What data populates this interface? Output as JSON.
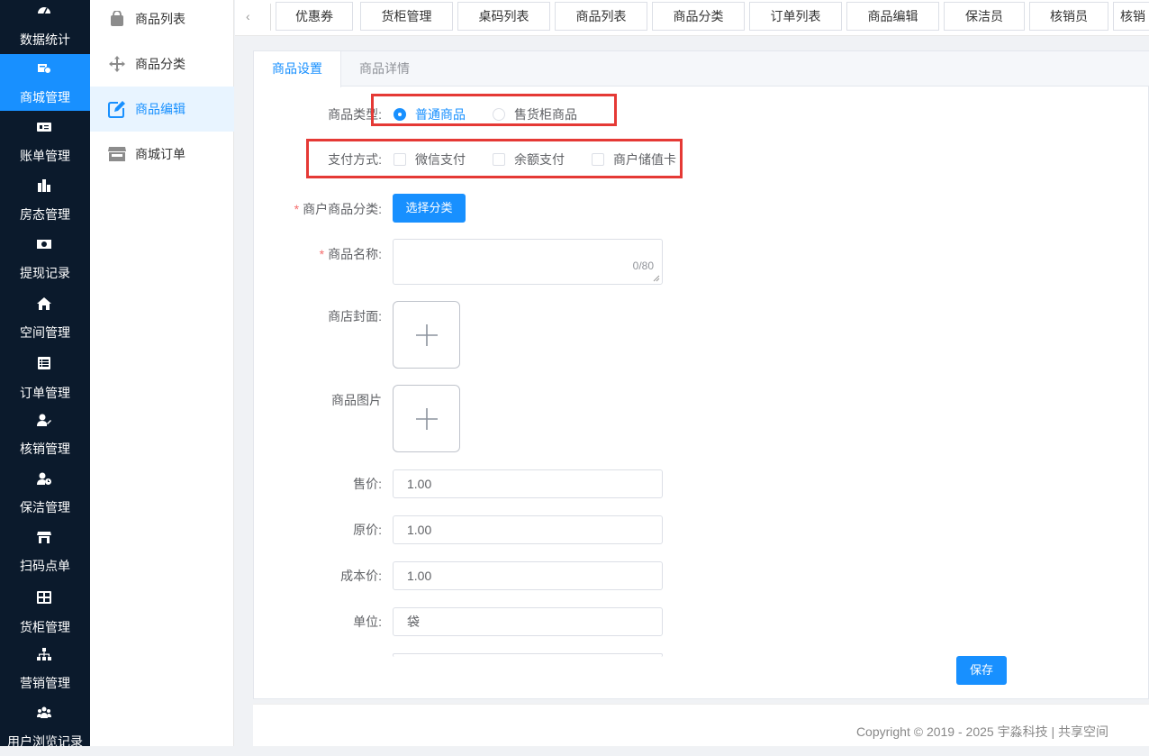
{
  "sidebar": {
    "items": [
      {
        "label": "数据统计",
        "icon": "dashboard-icon"
      },
      {
        "label": "商城管理",
        "icon": "shop-icon"
      },
      {
        "label": "账单管理",
        "icon": "bill-icon"
      },
      {
        "label": "房态管理",
        "icon": "building-icon"
      },
      {
        "label": "提现记录",
        "icon": "money-icon"
      },
      {
        "label": "空间管理",
        "icon": "home-icon"
      },
      {
        "label": "订单管理",
        "icon": "list-icon"
      },
      {
        "label": "核销管理",
        "icon": "user-edit-icon"
      },
      {
        "label": "保洁管理",
        "icon": "user-clock-icon"
      },
      {
        "label": "扫码点单",
        "icon": "store-icon"
      },
      {
        "label": "货柜管理",
        "icon": "grid-icon"
      },
      {
        "label": "营销管理",
        "icon": "sitemap-icon"
      },
      {
        "label": "用户浏览记录",
        "icon": "users-icon"
      }
    ],
    "active_index": 1
  },
  "subnav": {
    "items": [
      {
        "label": "商品列表",
        "icon": "shopping-bag-icon"
      },
      {
        "label": "商品分类",
        "icon": "move-icon"
      },
      {
        "label": "商品编辑",
        "icon": "edit-icon"
      },
      {
        "label": "商城订单",
        "icon": "storefront-icon"
      }
    ],
    "active_index": 2
  },
  "tabbar": {
    "prev_glyph": "‹",
    "tabs": [
      "优惠券",
      "货柜管理",
      "桌码列表",
      "商品列表",
      "商品分类",
      "订单列表",
      "商品编辑",
      "保洁员",
      "核销员",
      "核销"
    ]
  },
  "card": {
    "tabs": [
      "商品设置",
      "商品详情"
    ],
    "active_tab": 0
  },
  "form": {
    "product_type": {
      "label": "商品类型:",
      "options": [
        "普通商品",
        "售货柜商品"
      ],
      "selected": 0
    },
    "payment": {
      "label": "支付方式:",
      "options": [
        "微信支付",
        "余额支付",
        "商户储值卡"
      ]
    },
    "category": {
      "label": "商户商品分类:",
      "required_mark": "*",
      "button": "选择分类"
    },
    "name": {
      "label": "商品名称:",
      "required_mark": "*",
      "value": "",
      "counter": "0/80"
    },
    "cover": {
      "label": "商店封面:"
    },
    "images": {
      "label": "商品图片"
    },
    "price": {
      "label": "售价:",
      "value": "1.00"
    },
    "original_price": {
      "label": "原价:",
      "value": "1.00"
    },
    "cost_price": {
      "label": "成本价:",
      "value": "1.00"
    },
    "unit": {
      "label": "单位:",
      "value": "袋"
    },
    "save_button": "保存"
  },
  "footer": {
    "copyright": "Copyright © 2019 - 2025 宇淼科技 | 共享空间"
  },
  "colors": {
    "primary": "#1890ff",
    "sidebar_bg": "#0b1a2c",
    "highlight": "#e53935",
    "required": "#f56c6c"
  }
}
